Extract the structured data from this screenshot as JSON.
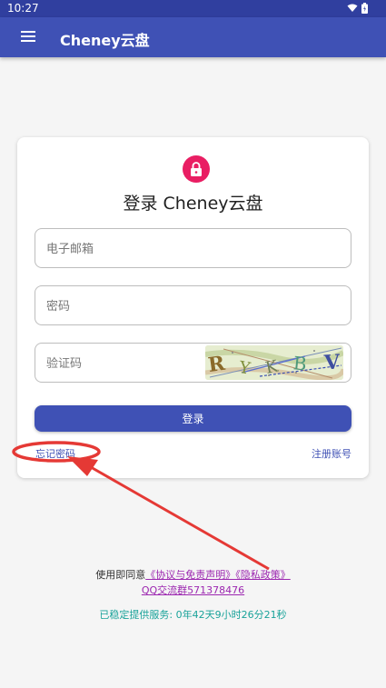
{
  "status_bar": {
    "time": "10:27"
  },
  "app_bar": {
    "title": "Cheney云盘"
  },
  "login": {
    "heading": "登录 Cheney云盘",
    "email_placeholder": "电子邮箱",
    "password_placeholder": "密码",
    "captcha_placeholder": "验证码",
    "captcha_chars": [
      "R",
      "Y",
      "K",
      "B",
      "V"
    ],
    "submit_label": "登录",
    "forgot_label": "忘记密码",
    "register_label": "注册账号"
  },
  "footer": {
    "agree_prefix": "使用即同意",
    "agree_links": "《协议与免责声明》《隐私政策》",
    "qq_group": "QQ交流群571378476",
    "uptime": "已稳定提供服务: 0年42天9小时26分21秒"
  },
  "colors": {
    "primary": "#3f51b5",
    "primary_dark": "#303f9f",
    "lock_badge": "#e91e63",
    "link_purple": "#9c27b0",
    "uptime_teal": "#1aa39a",
    "annotation_red": "#e53935"
  },
  "icons": {
    "menu": "hamburger-menu-icon",
    "lock": "lock-icon",
    "wifi": "wifi-icon",
    "battery": "battery-icon"
  }
}
